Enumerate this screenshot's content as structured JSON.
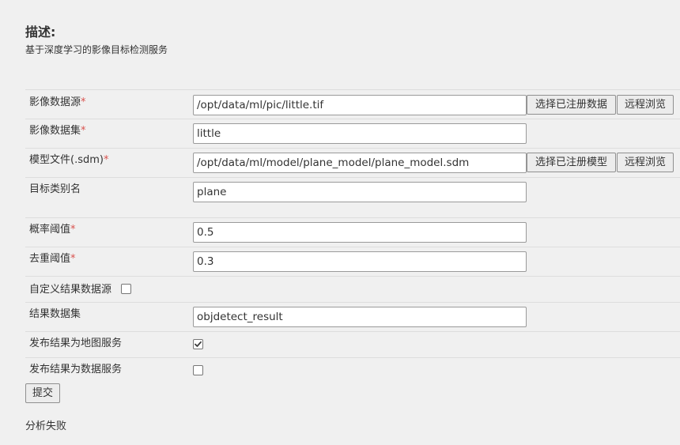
{
  "description": {
    "title": "描述:",
    "text": "基于深度学习的影像目标检测服务"
  },
  "form": {
    "image_source": {
      "label": "影像数据源",
      "required": "*",
      "value": "/opt/data/ml/pic/little.tif",
      "select_button": "选择已注册数据",
      "browse_button": "远程浏览"
    },
    "image_dataset": {
      "label": "影像数据集",
      "required": "*",
      "value": "little"
    },
    "model_file": {
      "label": "模型文件(.sdm)",
      "required": "*",
      "value": "/opt/data/ml/model/plane_model/plane_model.sdm",
      "select_button": "选择已注册模型",
      "browse_button": "远程浏览"
    },
    "target_class": {
      "label": "目标类别名",
      "value": "plane"
    },
    "probability_threshold": {
      "label": "概率阈值",
      "required": "*",
      "value": "0.5"
    },
    "nms_threshold": {
      "label": "去重阈值",
      "required": "*",
      "value": "0.3"
    },
    "custom_result_source": {
      "label": "自定义结果数据源",
      "checked": false
    },
    "result_dataset": {
      "label": "结果数据集",
      "value": "objdetect_result"
    },
    "publish_map_service": {
      "label": "发布结果为地图服务",
      "checked": true
    },
    "publish_data_service": {
      "label": "发布结果为数据服务",
      "checked": false
    }
  },
  "submit_label": "提交",
  "status_text": "分析失败"
}
